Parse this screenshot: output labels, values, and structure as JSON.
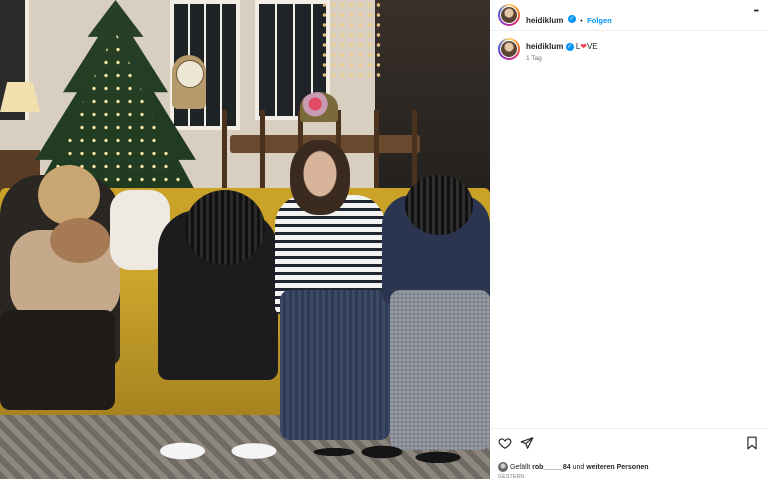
{
  "header": {
    "username": "heidiklum",
    "verified_icon": "verified-badge-icon",
    "separator": "•",
    "follow_label": "Folgen",
    "more_icon": "more-dots-icon",
    "more_glyph": "•••"
  },
  "caption": {
    "username": "heidiklum",
    "text_before": "L",
    "heart": "❤",
    "text_after": "VE",
    "time": "1 Tag"
  },
  "actions": {
    "like_icon": "heart-outline-icon",
    "share_icon": "paper-plane-icon",
    "save_icon": "bookmark-icon"
  },
  "likes": {
    "prefix": "Gefällt",
    "user": "rob_____84",
    "middle": "und",
    "suffix": "weiteren Personen"
  },
  "date": "GESTERN",
  "colors": {
    "accent": "#0095f6",
    "heart": "#ed4956",
    "text": "#262626",
    "secondary": "#737373",
    "sofa": "#c9a227"
  }
}
